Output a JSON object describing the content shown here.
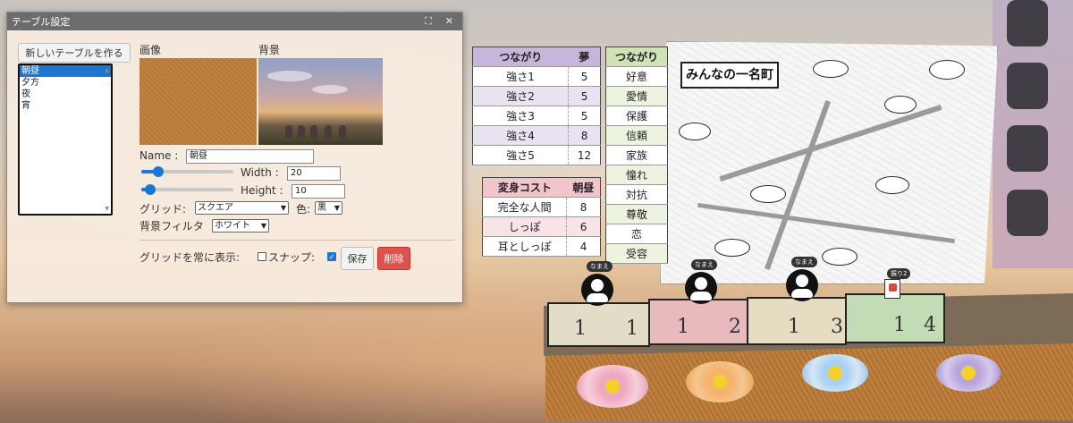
{
  "dialog": {
    "title": "テーブル設定",
    "new_table_button": "新しいテーブルを作る",
    "tables": [
      "朝昼",
      "夕方",
      "夜",
      "宵"
    ],
    "selected_table": "朝昼",
    "image_label": "画像",
    "background_label": "背景",
    "name_label": "Name :",
    "name_value": "朝昼",
    "width_label": "Width :",
    "width_value": "20",
    "width_slider_fraction": 0.18,
    "height_label": "Height :",
    "height_value": "10",
    "height_slider_fraction": 0.1,
    "grid_label": "グリッド:",
    "grid_value": "スクエア",
    "color_label": "色:",
    "color_value": "黒",
    "filter_label": "背景フィルタ",
    "filter_value": "ホワイト",
    "grid_always_label": "グリッドを常に表示:",
    "grid_always_checked": false,
    "snap_label": "スナップ:",
    "snap_checked": true,
    "save_button": "保存",
    "delete_button": "削除"
  },
  "map": {
    "title": "みんなの一名町"
  },
  "table1": {
    "headers": [
      "つながり",
      "夢"
    ],
    "rows": [
      [
        "強さ1",
        "5"
      ],
      [
        "強さ2",
        "5"
      ],
      [
        "強さ3",
        "5"
      ],
      [
        "強さ4",
        "8"
      ],
      [
        "強さ5",
        "12"
      ]
    ]
  },
  "table2": {
    "headers": [
      "変身コスト",
      "朝昼"
    ],
    "rows": [
      [
        "完全な人間",
        "8"
      ],
      [
        "しっぽ",
        "6"
      ],
      [
        "耳としっぽ",
        "4"
      ]
    ]
  },
  "table3": {
    "header": "つながり",
    "rows": [
      "好意",
      "愛情",
      "保護",
      "信頼",
      "家族",
      "憧れ",
      "対抗",
      "尊敬",
      "恋",
      "受容"
    ]
  },
  "board": {
    "cells": [
      {
        "num": "1",
        "sub": "1",
        "color": "#e3dcc6"
      },
      {
        "num": "1",
        "sub": "2",
        "color": "#e8b9bd"
      },
      {
        "num": "1",
        "sub": "3",
        "color": "#e6dcc2"
      },
      {
        "num": "1",
        "sub": "4",
        "color": "#c3dcb6"
      }
    ],
    "pieces": [
      {
        "tag": "なまえ"
      },
      {
        "tag": "なまえ"
      },
      {
        "tag": "なまえ"
      }
    ],
    "card_tag": "振り2"
  },
  "colors": {
    "accent": "#1e76d3",
    "delete": "#d9534f",
    "titlebar": "#6c6c6c"
  }
}
